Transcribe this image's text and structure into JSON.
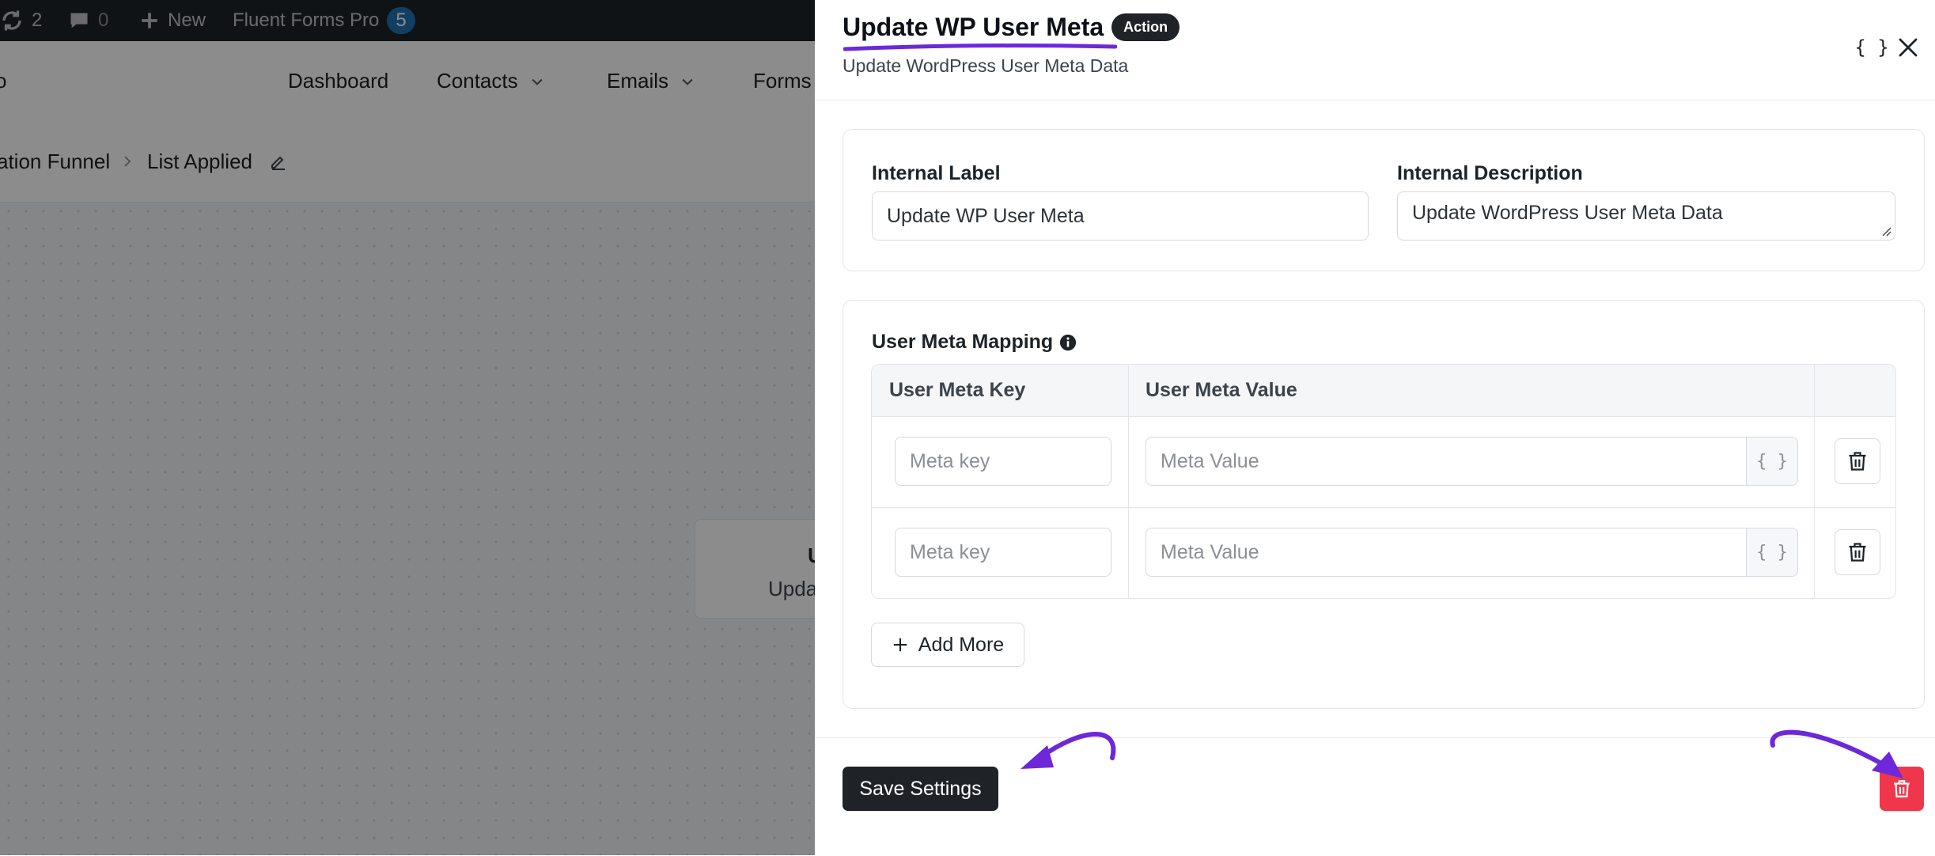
{
  "admin_bar": {
    "updates_count": "2",
    "comments_count": "0",
    "new_label": "New",
    "plugin_label": "Fluent Forms Pro",
    "plugin_badge": "5"
  },
  "top_nav": {
    "items": [
      "Dashboard",
      "Contacts",
      "Emails",
      "Forms"
    ],
    "logo_fragment": "o"
  },
  "breadcrumb": {
    "parent": "ation Funnel",
    "current": "List Applied"
  },
  "canvas_node": {
    "title": "U",
    "subtitle": "Upda"
  },
  "drawer": {
    "title": "Update WP User Meta",
    "badge": "Action",
    "subtitle": "Update WordPress User Meta Data",
    "smartcode_icon": "{ }",
    "internal_label": {
      "label": "Internal Label",
      "value": "Update WP User Meta"
    },
    "internal_description": {
      "label": "Internal Description",
      "value": "Update WordPress User Meta Data"
    },
    "mapping": {
      "label": "User Meta Mapping",
      "headers": [
        "User Meta Key",
        "User Meta Value"
      ],
      "rows": [
        {
          "key_placeholder": "Meta key",
          "value_placeholder": "Meta Value",
          "value_btn": "{ }"
        },
        {
          "key_placeholder": "Meta key",
          "value_placeholder": "Meta Value",
          "value_btn": "{ }"
        }
      ],
      "add_more": "Add More"
    },
    "footer": {
      "save_label": "Save Settings"
    }
  },
  "colors": {
    "accent_purple": "#6d28d9",
    "danger_red": "#f0364b",
    "dark_button": "#1f2328"
  }
}
